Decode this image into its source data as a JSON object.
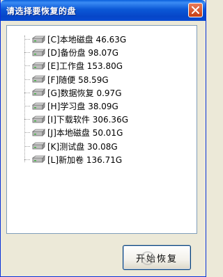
{
  "window": {
    "title": "请选择要恢复的盘",
    "close_icon": "close-icon"
  },
  "drives": [
    {
      "label": "[C]本地磁盘 46.63G",
      "icon": "drive-icon"
    },
    {
      "label": "[D]备份盘 98.07G",
      "icon": "drive-icon"
    },
    {
      "label": "[E]工作盘 153.80G",
      "icon": "drive-icon"
    },
    {
      "label": "[F]随便 58.59G",
      "icon": "drive-icon"
    },
    {
      "label": "[G]数据恢复 0.97G",
      "icon": "drive-icon"
    },
    {
      "label": "[H]学习盘 38.09G",
      "icon": "drive-icon"
    },
    {
      "label": "[I]下载软件 306.36G",
      "icon": "drive-icon"
    },
    {
      "label": "[J]本地磁盘 50.01G",
      "icon": "drive-icon"
    },
    {
      "label": "[K]测试盘 30.08G",
      "icon": "drive-icon"
    },
    {
      "label": "[L]新加卷 136.71G",
      "icon": "drive-icon"
    }
  ],
  "actions": {
    "start_label": "开始恢复"
  },
  "watermark": {
    "icon": "logo-icon"
  },
  "colors": {
    "titlebar": "#0a4cd2",
    "window_bg": "#ece9d8",
    "panel_bg": "#ffffff",
    "close_btn": "#c63e13"
  }
}
